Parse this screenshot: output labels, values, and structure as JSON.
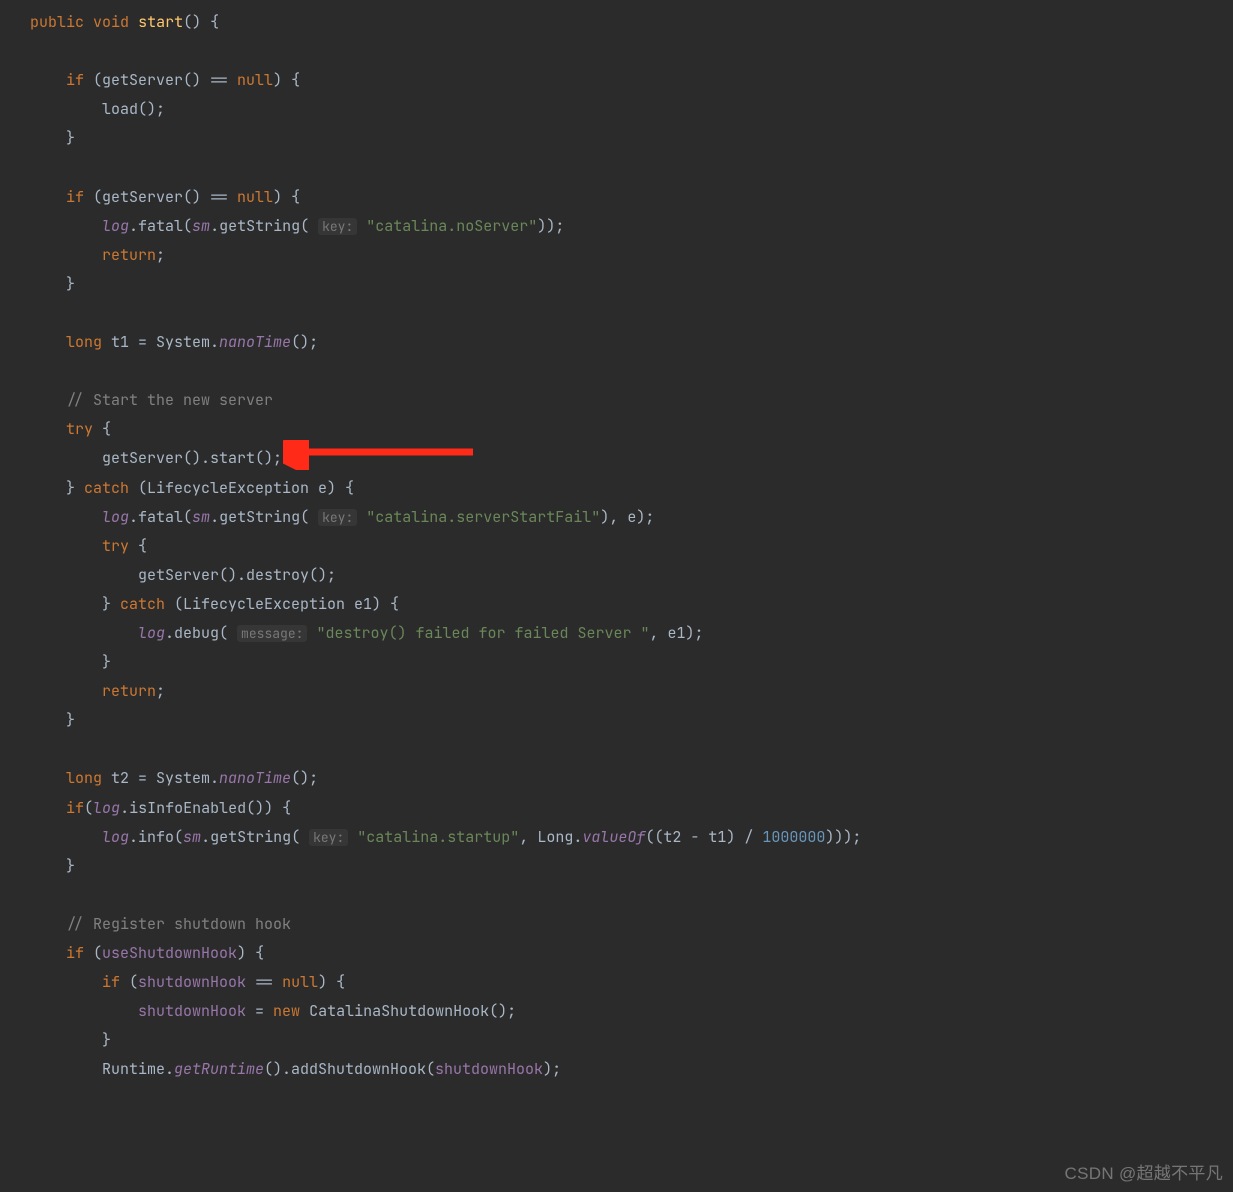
{
  "code": {
    "k_public": "public",
    "k_void": "void",
    "m_start": "start",
    "k_if": "if",
    "k_null": "null",
    "k_return": "return",
    "k_long": "long",
    "k_try": "try",
    "k_catch": "catch",
    "k_new": "new",
    "f_log": "log",
    "f_sm": "sm",
    "f_use": "useShutdownHook",
    "f_sh": "shutdownHook",
    "m_nano": "nanoTime",
    "m_valueOf": "valueOf",
    "m_getRuntime": "getRuntime",
    "hint_key": "key:",
    "hint_msg": "message:",
    "s_noServer": "\"catalina.noServer\"",
    "s_startFail": "\"catalina.serverStartFail\"",
    "s_destroyFail": "\"destroy() failed for failed Server \"",
    "s_startup": "\"catalina.startup\"",
    "n_million": "1000000",
    "c_startNew": "// Start the new server",
    "c_regHook": "// Register shutdown hook",
    "t0": "() {",
    "t1": " (getServer() == ",
    "t1b": ") {",
    "t2": "        load();",
    "t3": "    }",
    "t5": "        ",
    "t6": ".fatal(",
    "t7": ".getString( ",
    "t8": "));",
    "t9": ";",
    "t10": " t1 = System.",
    "t11": "();",
    "t12": " {",
    "t13": "        getServer().start();",
    "t14": "    } ",
    "t15": " (LifecycleException e) {",
    "t16": "), e);",
    "t17": "            getServer().destroy();",
    "t18": "        } ",
    "t19": " (LifecycleException e1) {",
    "t20": "            ",
    "t21": ".debug( ",
    "t22": ", e1);",
    "t23": "        }",
    "t24": " t2 = System.",
    "t25": "(",
    "t26": ".isInfoEnabled()) {",
    "t27": ".info(",
    "t28": ", Long.",
    "t29": "((t2 - t1) / ",
    "t30": ")));",
    "t31": " (",
    "t32": " == ",
    "t33": "            ",
    "t34": " = ",
    "t35": " CatalinaShutdownHook();",
    "t36": "        Runtime.",
    "t37": "().addShutdownHook(",
    "t38": ");"
  },
  "watermark": "CSDN @超越不平凡"
}
